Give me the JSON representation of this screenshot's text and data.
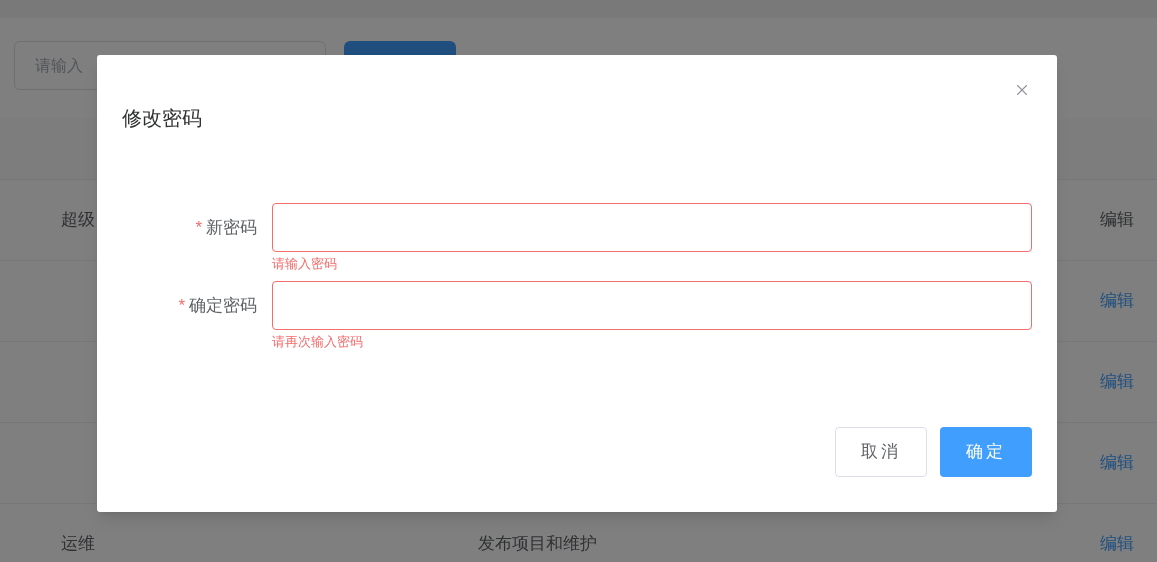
{
  "page": {
    "search": {
      "placeholder": "请输入"
    },
    "table": {
      "rows": [
        {
          "role": "超级",
          "edit": {
            "label": "编辑",
            "disabled": true
          }
        },
        {
          "edit": {
            "label": "编辑",
            "disabled": false
          }
        },
        {
          "edit": {
            "label": "编辑",
            "disabled": false
          }
        },
        {
          "edit": {
            "label": "编辑",
            "disabled": false
          }
        },
        {
          "role": "运维",
          "description": "发布项目和维护",
          "edit": {
            "label": "编辑",
            "disabled": false
          }
        }
      ]
    }
  },
  "dialog": {
    "title": "修改密码",
    "fields": [
      {
        "label": "新密码",
        "required_mark": "*",
        "error": "请输入密码"
      },
      {
        "label": "确定密码",
        "required_mark": "*",
        "error": "请再次输入密码"
      }
    ],
    "buttons": [
      {
        "label": "取消",
        "kind": "secondary"
      },
      {
        "label": "确定",
        "kind": "primary"
      }
    ]
  }
}
